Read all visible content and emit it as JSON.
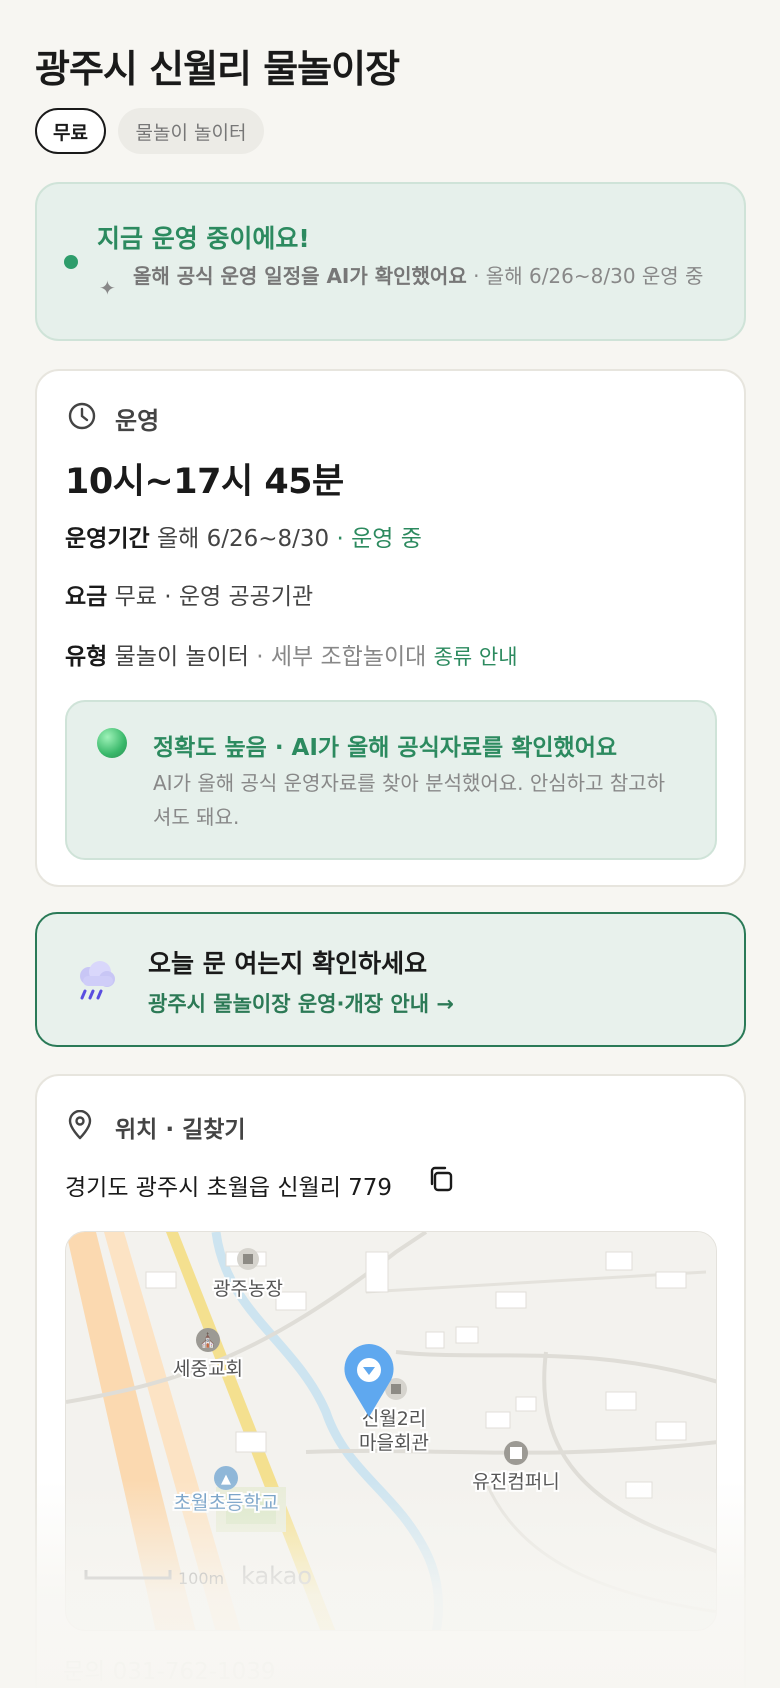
{
  "header": {
    "title": "광주시 신월리 물놀이장"
  },
  "chips": {
    "free": "무료",
    "type": "물놀이 놀이터"
  },
  "status": {
    "title": "지금 운영 중이에요!",
    "sparkle_icon": "sparkle-icon",
    "confirm_text": "올해 공식 운영 일정을 AI가 확인했어요",
    "detail": " · 올해 6/26~8/30 운영 중",
    "dot_color": "#2e9d6b"
  },
  "operation": {
    "label": "운영",
    "icon": "clock-icon",
    "hours": "10시~17시 45분",
    "period_label": "운영기간",
    "period_value": "올해 6/26~8/30",
    "period_status": "· 운영 중",
    "fee_label": "요금",
    "fee_value": "무료 · 운영 공공기관",
    "type_label": "유형",
    "type_value": "물놀이 놀이터",
    "type_detail": "· 세부 조합놀이대",
    "type_link": "종류 안내",
    "accuracy_title": "정확도 높음 · AI가 올해 공식자료를 확인했어요",
    "accuracy_desc": "AI가 올해 공식 운영자료를 찾아 분석했어요. 안심하고 참고하셔도 돼요."
  },
  "today": {
    "icon": "rain-cloud-icon",
    "title": "오늘 문 여는지 확인하세요",
    "link": "광주시 물놀이장 운영·개장 안내 →"
  },
  "location": {
    "label": "위치 · 길찾기",
    "icon": "location-pin-icon",
    "address": "경기도 광주시 초월읍 신월리 779",
    "copy_icon": "copy-icon",
    "map": {
      "labels": [
        "광주농장",
        "세중교회",
        "신월2리",
        "마을회관",
        "유진컴퍼니",
        "초월초등학교"
      ],
      "scale": "100m",
      "brand": "kakao"
    }
  },
  "contact": {
    "text": "문의 031-762-1039"
  },
  "colors": {
    "accent": "#2c8a5f",
    "status_bg": "#e6f0eb",
    "page_bg": "#f7f6f2"
  }
}
